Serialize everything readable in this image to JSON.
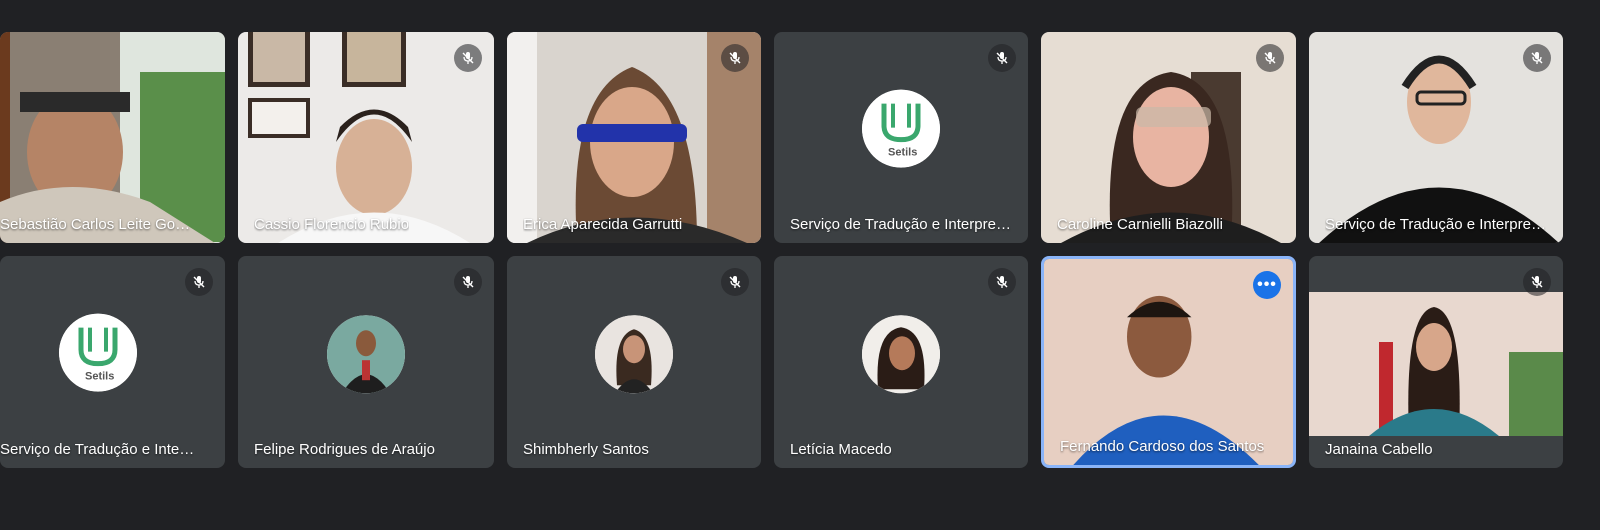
{
  "participants": [
    {
      "name": "Sebastião Carlos Leite Gonçalves",
      "muted": false
    },
    {
      "name": "Cassio Florencio Rubio",
      "muted": true
    },
    {
      "name": "Erica Aparecida Garrutti",
      "muted": true
    },
    {
      "name": "Serviço de Tradução e Interpretação",
      "muted": true,
      "avatar_logo": "Setils"
    },
    {
      "name": "Caroline Carnielli Biazolli",
      "muted": true
    },
    {
      "name": "Serviço de Tradução e Interpretação",
      "muted": true
    },
    {
      "name": "Serviço de Tradução e Interpretação",
      "muted": true,
      "avatar_logo": "Setils"
    },
    {
      "name": "Felipe Rodrigues de Araújo",
      "muted": true
    },
    {
      "name": "Shimbherly Santos",
      "muted": true
    },
    {
      "name": "Letícia Macedo",
      "muted": true
    },
    {
      "name": "Fernando Cardoso dos Santos",
      "muted": false,
      "active_speaker": true
    },
    {
      "name": "Janaina Cabello",
      "muted": true
    }
  ],
  "icons": {
    "mic_off": "mic-off-icon",
    "more": "more-options-icon"
  },
  "colors": {
    "background": "#202124",
    "tile": "#3c4043",
    "active_border": "#8ab4f8",
    "more_button": "#1a73e8",
    "logo_green": "#3aa76d"
  }
}
